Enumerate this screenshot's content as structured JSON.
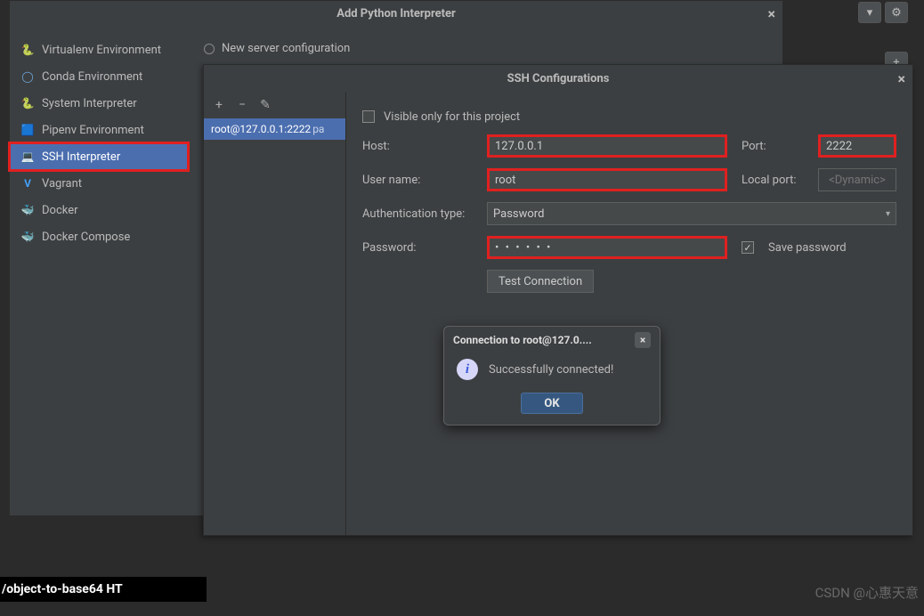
{
  "outer": {
    "title": "Add Python Interpreter",
    "new_server_label": "New server configuration"
  },
  "sidebar": {
    "items": [
      {
        "label": "Virtualenv Environment",
        "icon": "🐍",
        "icon_name": "python-icon"
      },
      {
        "label": "Conda Environment",
        "icon": "◯",
        "icon_name": "conda-icon"
      },
      {
        "label": "System Interpreter",
        "icon": "🐍",
        "icon_name": "python-icon"
      },
      {
        "label": "Pipenv Environment",
        "icon": "🟦",
        "icon_name": "pipenv-icon"
      },
      {
        "label": "SSH Interpreter",
        "icon": "💻",
        "icon_name": "ssh-icon"
      },
      {
        "label": "Vagrant",
        "icon": "V",
        "icon_name": "vagrant-icon"
      },
      {
        "label": "Docker",
        "icon": "🐳",
        "icon_name": "docker-icon"
      },
      {
        "label": "Docker Compose",
        "icon": "🐳",
        "icon_name": "docker-compose-icon"
      }
    ]
  },
  "ssh": {
    "title": "SSH Configurations",
    "list_item": "root@127.0.0.1:2222",
    "list_item_tail": "pa",
    "visible_only_label": "Visible only for this project",
    "visible_only_checked": false,
    "host_label": "Host:",
    "host_value": "127.0.0.1",
    "port_label": "Port:",
    "port_value": "2222",
    "username_label": "User name:",
    "username_value": "root",
    "localport_label": "Local port:",
    "localport_placeholder": "<Dynamic>",
    "authtype_label": "Authentication type:",
    "authtype_value": "Password",
    "password_label": "Password:",
    "password_mask": "• • • • • •",
    "save_password_label": "Save password",
    "save_password_checked": true,
    "test_connection_label": "Test Connection"
  },
  "popup": {
    "title": "Connection to root@127.0....",
    "message": "Successfully connected!",
    "ok_label": "OK"
  },
  "terminal": {
    "text": "/object-to-base64 HT"
  },
  "watermark": {
    "text": "CSDN @心惠天意"
  },
  "glyphs": {
    "close_x": "×",
    "gear": "⚙",
    "chevron": "▾",
    "plus": "+",
    "minus": "−",
    "pencil": "✎",
    "check": "✓"
  }
}
